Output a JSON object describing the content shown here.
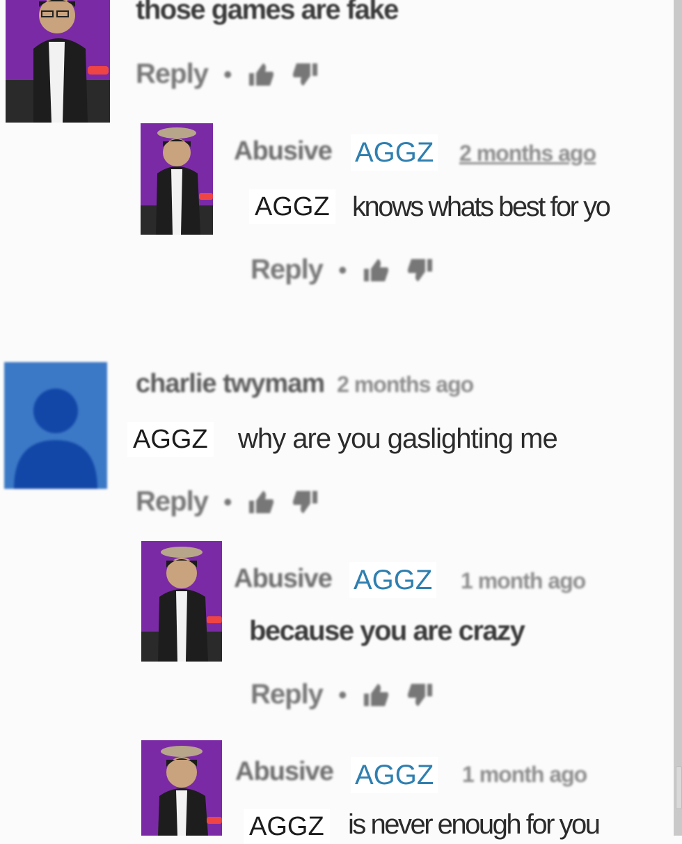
{
  "comments": [
    {
      "text_visible": "those games are fake",
      "reply_label": "Reply",
      "separator": "•"
    },
    {
      "author": "Abusive",
      "author_tag": "AGGZ",
      "time": "2 months ago",
      "prefix": "AGGZ",
      "text": "knows whats best for yo",
      "reply_label": "Reply",
      "separator": "•"
    },
    {
      "author": "charlie twymam",
      "time": "2 months ago",
      "prefix": "AGGZ",
      "text": "why are you gaslighting me",
      "reply_label": "Reply",
      "separator": "•"
    },
    {
      "author": "Abusive",
      "author_tag": "AGGZ",
      "time": "1 month ago",
      "text": "because you are crazy",
      "reply_label": "Reply",
      "separator": "•"
    },
    {
      "author": "Abusive",
      "author_tag": "AGGZ",
      "time": "1 month ago",
      "prefix": "AGGZ",
      "text": "is never enough for you"
    }
  ],
  "icons": {
    "like": "thumbs-up-icon",
    "dislike": "thumbs-down-icon",
    "avatar": "user-avatar"
  },
  "colors": {
    "avatar_bg": "#7b2aa6",
    "default_avatar": "#3b78c6",
    "aggz_tag": "#2f7fb0"
  }
}
